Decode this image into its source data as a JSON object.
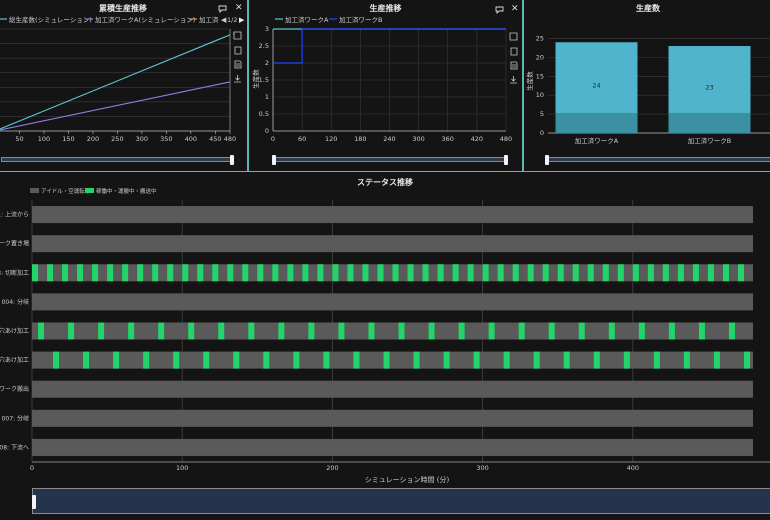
{
  "panels": {
    "cumulative": {
      "title": "累積生産推移",
      "legend": [
        "総生産数(シミュレーション)",
        "加工済ワークA(シミュレーション)",
        "加工済"
      ],
      "legend_colors": [
        "#5ec8d8",
        "#8d7fe8",
        "#d8a070"
      ],
      "pager": "1/2",
      "xticks": [
        "50",
        "100",
        "150",
        "200",
        "250",
        "300",
        "350",
        "400",
        "450",
        "480"
      ]
    },
    "production": {
      "title": "生産推移",
      "legend": [
        "加工済ワークA",
        "加工済ワークB"
      ],
      "legend_colors": [
        "#5ec8d8",
        "#2244ff"
      ],
      "ylabel": "生産数",
      "yticks": [
        "0",
        "0.5",
        "1",
        "1.5",
        "2",
        "2.5",
        "3"
      ],
      "xticks": [
        "0",
        "60",
        "120",
        "180",
        "240",
        "300",
        "360",
        "420",
        "480"
      ]
    },
    "count": {
      "title": "生産数",
      "ylabel": "生産数",
      "yticks": [
        "0",
        "5",
        "10",
        "15",
        "20",
        "25"
      ],
      "bar_color": "#4fb4cc"
    },
    "status": {
      "title": "ステータス推移",
      "legend": [
        "アイドル・空運転中",
        "稼働中・運搬中・搬送中"
      ],
      "legend_colors": [
        "#5a5a5a",
        "#22d46a"
      ],
      "rows": [
        "1: 上流から",
        "ーク置き場",
        "3: 切断加工",
        "004: 分岐",
        "穴あけ加工",
        "穴あけ加工",
        "ワーク搬出",
        "007: 分岐",
        "08: 下流へ"
      ],
      "xlabel": "シミュレーション時間 (分)",
      "xticks": [
        "0",
        "100",
        "200",
        "300",
        "400"
      ]
    }
  },
  "chart_data": [
    {
      "type": "line",
      "title": "累積生産推移",
      "x_range": [
        0,
        480
      ],
      "series": [
        {
          "name": "総生産数(シミュレーション)",
          "x": [
            0,
            460,
            480
          ],
          "y": [
            0,
            47,
            49
          ]
        },
        {
          "name": "加工済ワークA(シミュレーション)",
          "x": [
            0,
            460,
            480
          ],
          "y": [
            0,
            24,
            25
          ]
        }
      ]
    },
    {
      "type": "line",
      "title": "生産推移",
      "ylabel": "生産数",
      "ylim": [
        0,
        3
      ],
      "xlim": [
        0,
        480
      ],
      "series": [
        {
          "name": "加工済ワークA",
          "x": [
            0,
            60,
            60,
            480
          ],
          "y": [
            3,
            3,
            3,
            3
          ]
        },
        {
          "name": "加工済ワークB",
          "x": [
            0,
            60,
            60,
            480
          ],
          "y": [
            2,
            2,
            3,
            3
          ]
        }
      ]
    },
    {
      "type": "bar",
      "title": "生産数",
      "ylabel": "生産数",
      "ylim": [
        0,
        25
      ],
      "categories": [
        "加工済ワークA",
        "加工済ワークB"
      ],
      "values": [
        24,
        23
      ]
    },
    {
      "type": "bar",
      "title": "ステータス推移",
      "xlabel": "シミュレーション時間 (分)",
      "xlim": [
        0,
        480
      ],
      "rows": [
        "1: 上流から",
        "ーク置き場",
        "3: 切断加工",
        "004: 分岐",
        "穴あけ加工",
        "穴あけ加工",
        "ワーク搬出",
        "007: 分岐",
        "08: 下流へ"
      ],
      "active_period": [
        0,
        10,
        10,
        20,
        20
      ],
      "active_duration": [
        0,
        0,
        4,
        0,
        4,
        4,
        0,
        0,
        0
      ],
      "active_offset": [
        0,
        0,
        0,
        0,
        4,
        14,
        0,
        0,
        0
      ]
    }
  ]
}
